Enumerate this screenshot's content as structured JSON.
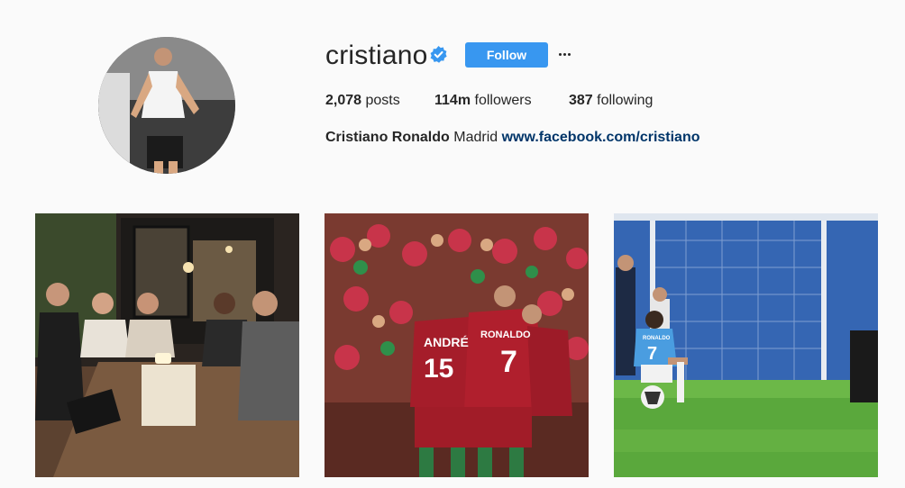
{
  "profile": {
    "username": "cristiano",
    "verified": true,
    "follow_label": "Follow",
    "more_icon": "ellipsis-icon",
    "avatar_icon": "avatar"
  },
  "stats": {
    "posts_count": "2,078",
    "posts_label": "posts",
    "followers_count": "114m",
    "followers_label": "followers",
    "following_count": "387",
    "following_label": "following"
  },
  "bio": {
    "full_name": "Cristiano Ronaldo",
    "text": "Madrid",
    "link": "www.facebook.com/cristiano"
  },
  "posts": [
    {
      "subject": "group-dinner-photo"
    },
    {
      "subject": "football-celebration-photo",
      "shirt_a_name": "ANDRÉ",
      "shirt_a_number": "15",
      "shirt_b_name": "RONALDO",
      "shirt_b_number": "7"
    },
    {
      "subject": "boy-on-football-photo",
      "shirt_name": "RONALDO",
      "shirt_number": "7"
    }
  ],
  "colors": {
    "accent": "#3897f0",
    "verified": "#3897f0",
    "link": "#003569",
    "text": "#262626",
    "background": "#fafafa"
  }
}
